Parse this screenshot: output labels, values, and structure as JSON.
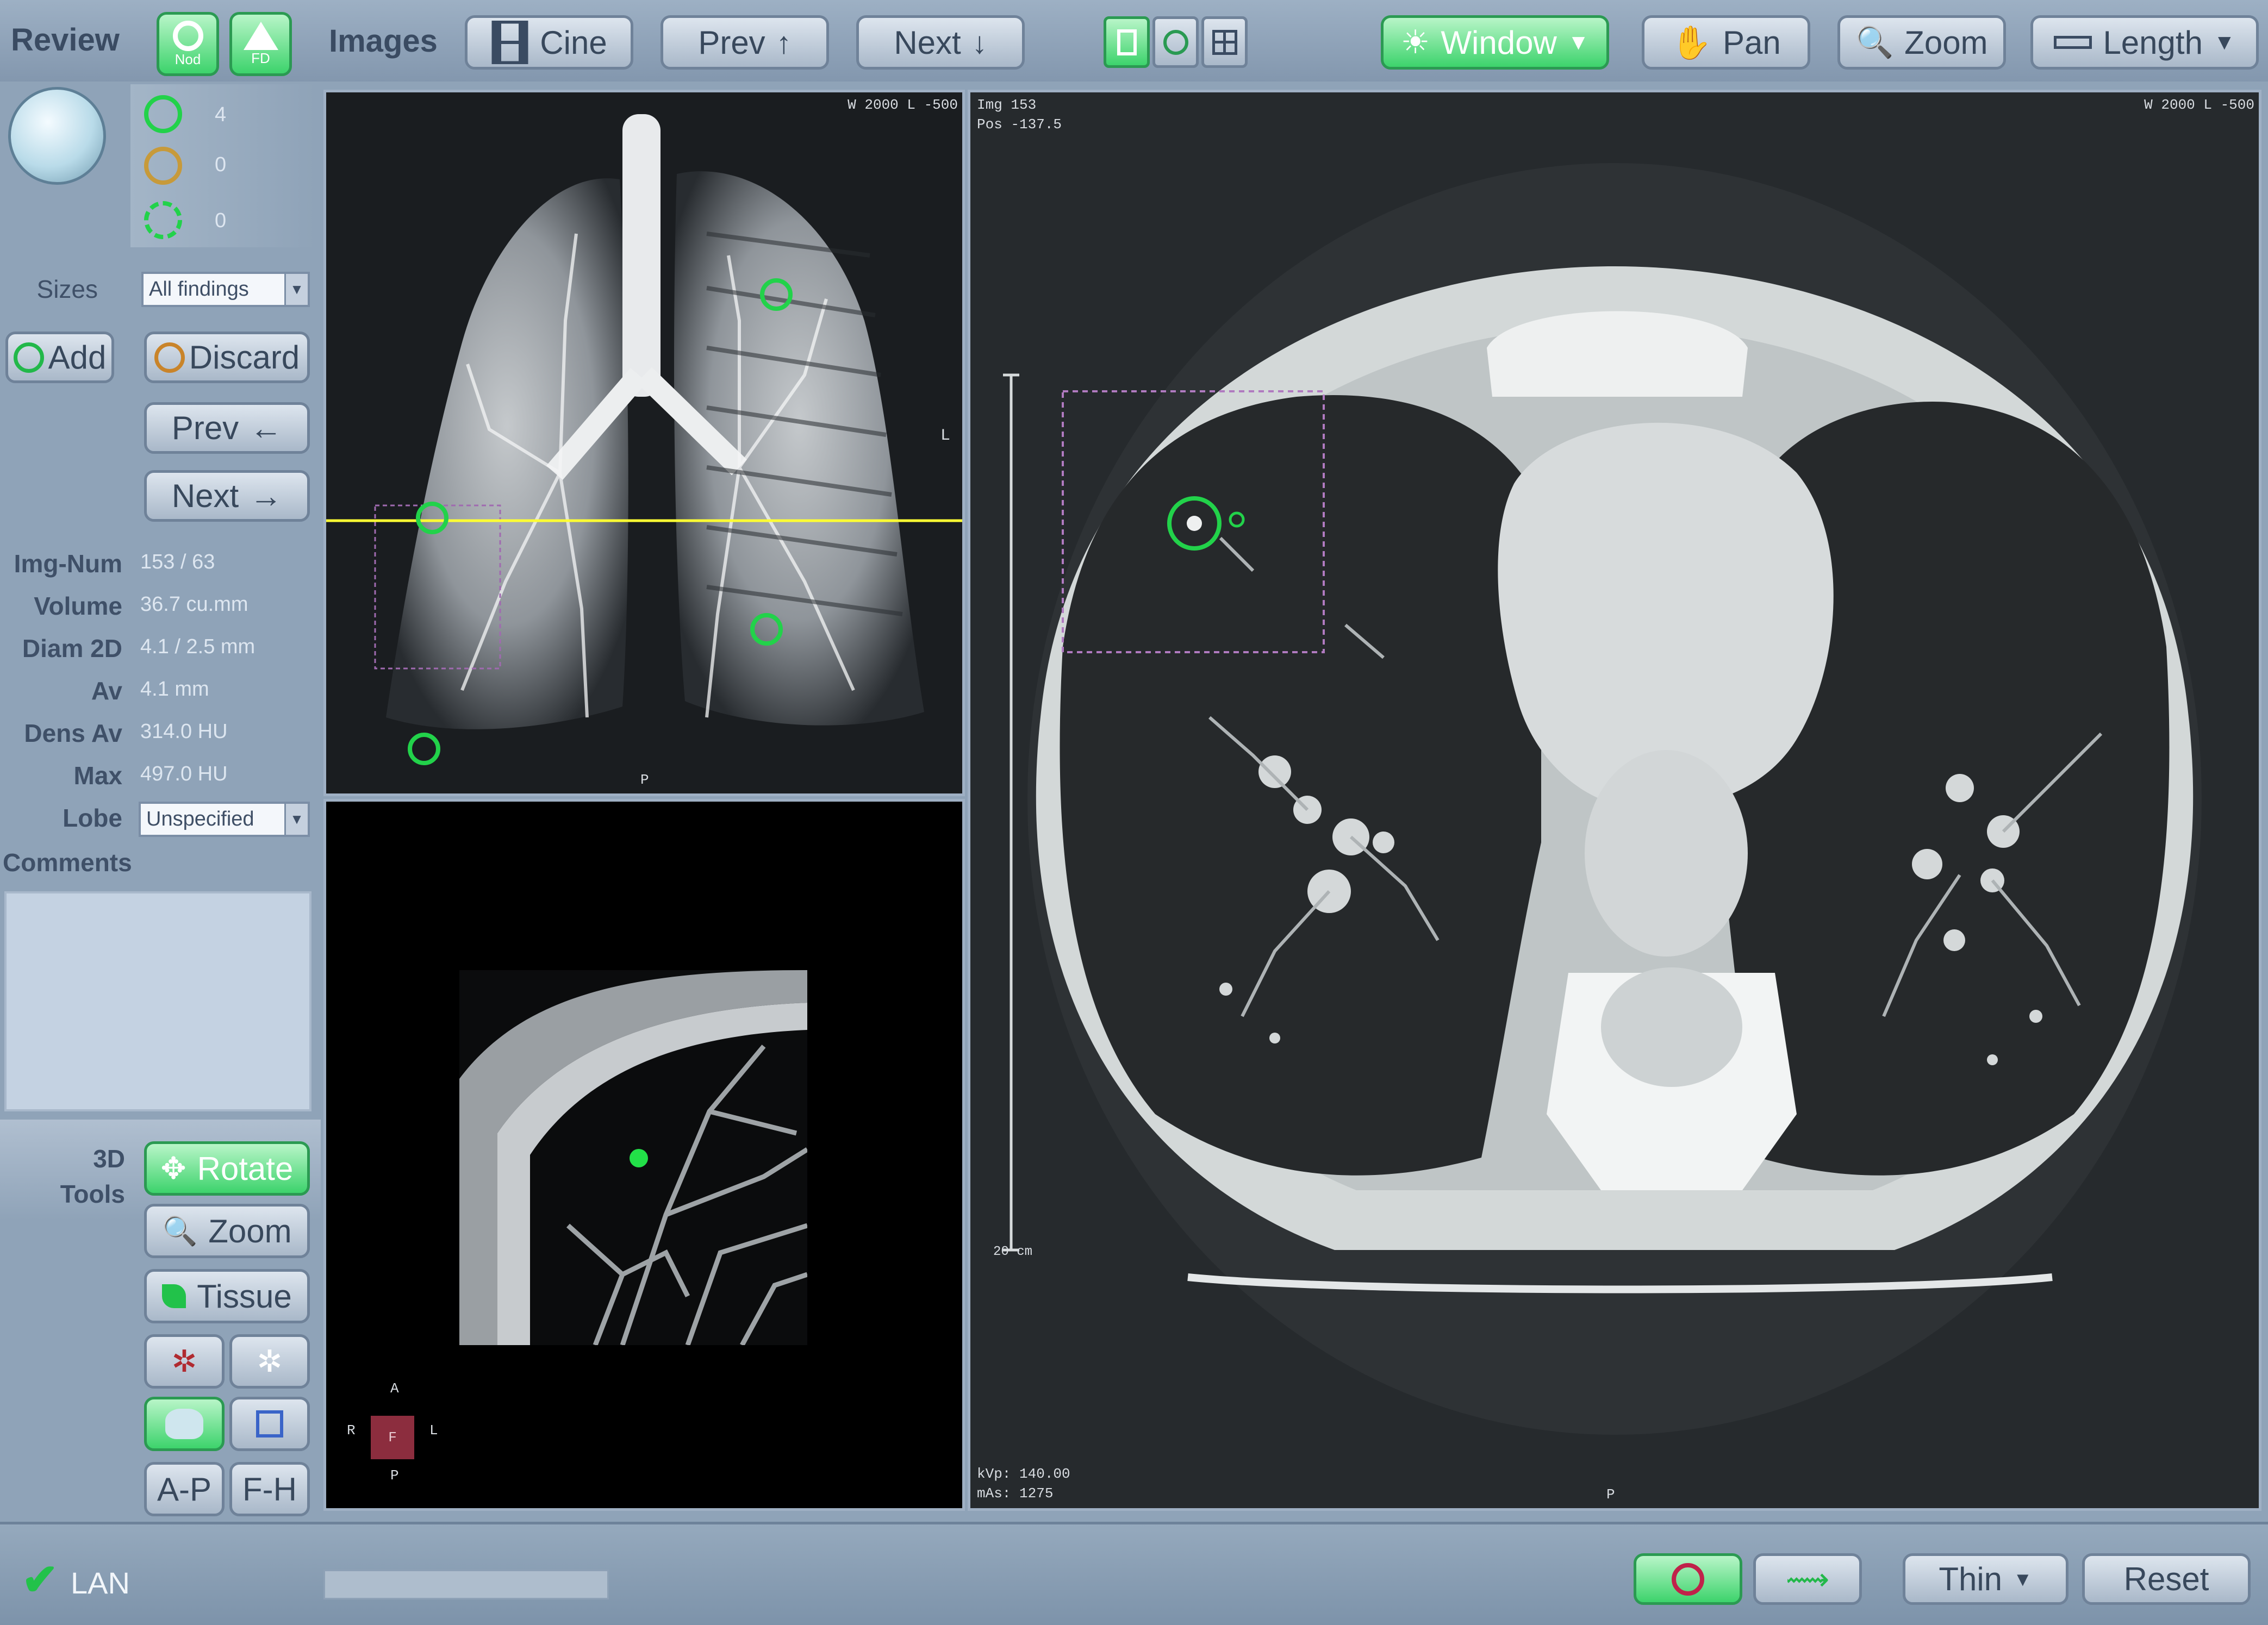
{
  "toolbar": {
    "review_label": "Review",
    "nod_label": "Nod",
    "fd_label": "FD",
    "images_label": "Images",
    "cine_label": "Cine",
    "prev_label": "Prev",
    "next_label": "Next",
    "window_label": "Window",
    "pan_label": "Pan",
    "zoom_label": "Zoom",
    "length_label": "Length"
  },
  "findings": {
    "counts": [
      "4",
      "0",
      "0"
    ],
    "sizes_label": "Sizes",
    "sizes_value": "All findings",
    "add_label": "Add",
    "discard_label": "Discard",
    "prev_label": "Prev",
    "next_label": "Next"
  },
  "measurements": [
    {
      "label": "Img-Num",
      "value": "153 / 63"
    },
    {
      "label": "Volume",
      "value": "36.7 cu.mm"
    },
    {
      "label": "Diam 2D",
      "value": "4.1 / 2.5 mm"
    },
    {
      "label": "Av",
      "value": "4.1 mm"
    },
    {
      "label": "Dens Av",
      "value": "314.0 HU"
    },
    {
      "label": "Max",
      "value": "497.0 HU"
    }
  ],
  "lobe": {
    "label": "Lobe",
    "value": "Unspecified"
  },
  "comments_label": "Comments",
  "tools3d": {
    "title_line1": "3D",
    "title_line2": "Tools",
    "rotate_label": "Rotate",
    "zoom_label": "Zoom",
    "tissue_label": "Tissue",
    "ap_label": "A-P",
    "fh_label": "F-H"
  },
  "views": {
    "mip_window": "W 2000 L -500",
    "mip_side": "L",
    "mip_bottom": "P",
    "orient_a": "A",
    "orient_r": "R",
    "orient_l": "L",
    "orient_p": "P",
    "orient_center": "F",
    "axial_img": "Img 153",
    "axial_pos": "Pos -137.5",
    "axial_window": "W 2000 L -500",
    "scale_label": "20 cm",
    "kvp": "kVp: 140.00",
    "mas": "mAs: 1275",
    "axial_bottom": "P"
  },
  "status": {
    "lan_label": "LAN",
    "thin_label": "Thin",
    "reset_label": "Reset"
  },
  "colors": {
    "accent_green": "#22d24a",
    "panel_bg": "#8fa3b8",
    "crosshair": "#ffff33"
  }
}
